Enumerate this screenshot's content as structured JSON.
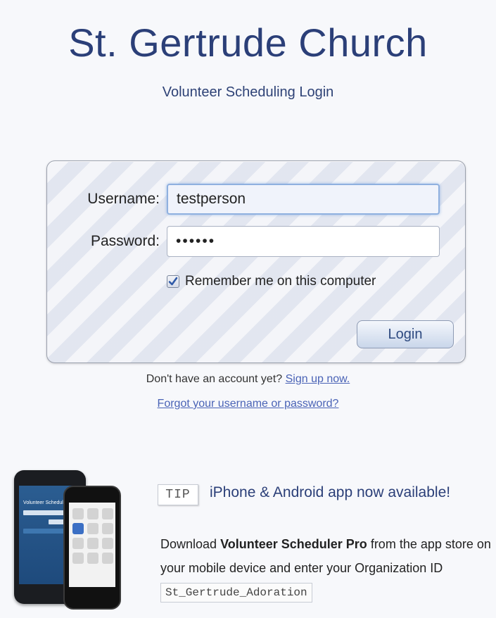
{
  "header": {
    "title": "St. Gertrude Church",
    "subtitle": "Volunteer Scheduling Login"
  },
  "login_form": {
    "username_label": "Username:",
    "username_value": "testperson",
    "password_label": "Password:",
    "password_value": "••••••",
    "remember_label": "Remember me on this computer",
    "remember_checked": true,
    "login_button": "Login"
  },
  "account_links": {
    "no_account_text": "Don't have an account yet?",
    "signup_link": "Sign up now.",
    "forgot_link": "Forgot your username or password?"
  },
  "promo": {
    "tip_badge": "TIP",
    "tip_headline": "iPhone & Android app now available!",
    "download_prefix": "Download",
    "app_name": "Volunteer Scheduler Pro",
    "download_middle": "from the app store on your mobile device and enter your",
    "org_id_label": "Organization ID",
    "org_id_value": "St_Gertrude_Adoration",
    "phone_screen_title": "Volunteer Scheduler Pro"
  },
  "colors": {
    "title": "#2b3f78",
    "link": "#4a63b6",
    "checkbox_check": "#2f5aa8"
  },
  "icons": [
    "checkmark-icon",
    "android-phone-image",
    "iphone-image"
  ]
}
